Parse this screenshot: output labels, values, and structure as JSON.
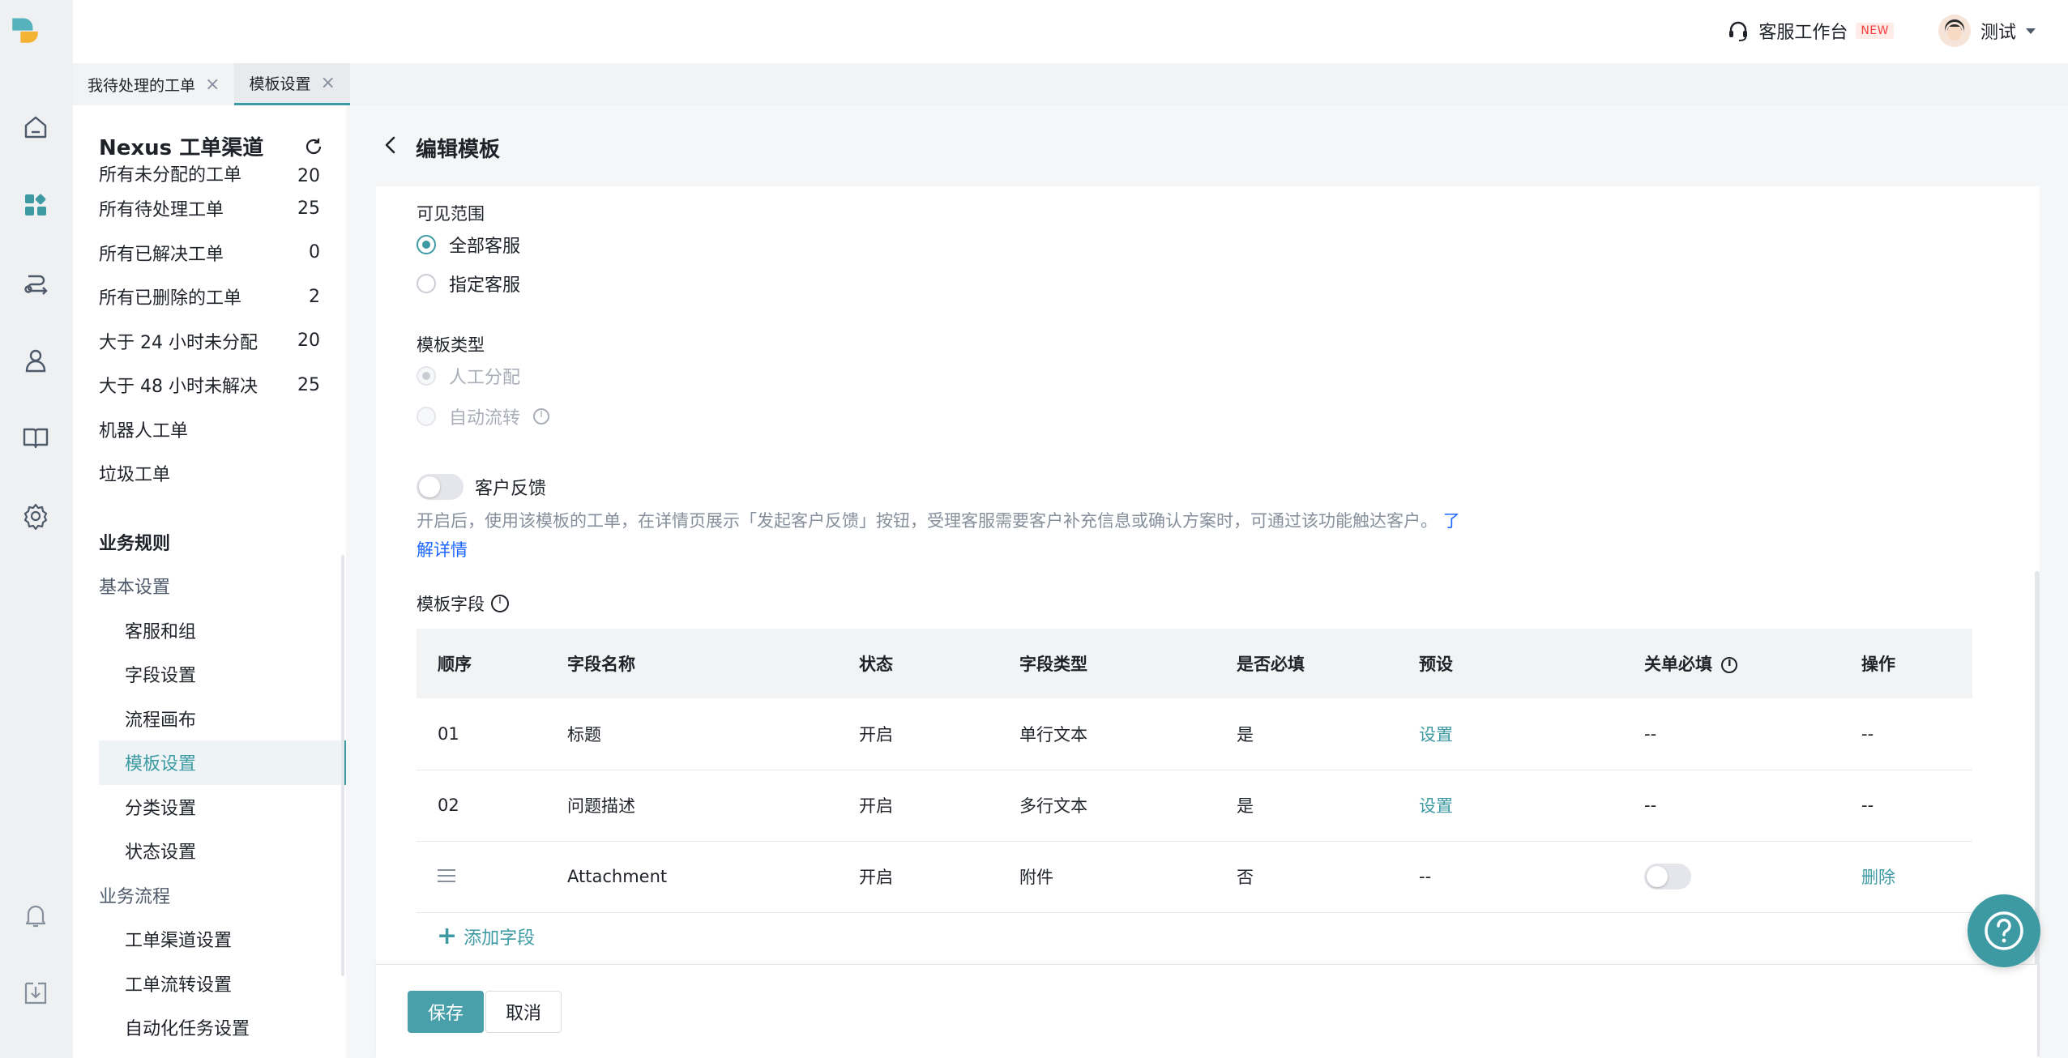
{
  "colors": {
    "accent": "#3d9aa3",
    "link": "#1a66ff",
    "danger": "#f53f3f"
  },
  "rail": {
    "icons": [
      "logo-icon",
      "home-icon",
      "apps-icon",
      "flow-icon",
      "user-icon",
      "book-icon",
      "gear-icon",
      "bell-icon",
      "download-icon"
    ]
  },
  "header": {
    "workbench_label": "客服工作台",
    "new_badge": "NEW",
    "user_name": "测试"
  },
  "tabs": [
    {
      "label": "我待处理的工单",
      "close": "×"
    },
    {
      "label": "模板设置",
      "close": "×"
    }
  ],
  "sidebar": {
    "title": "Nexus 工单渠道",
    "items": [
      {
        "label": "所有未分配的工单",
        "count": "20"
      },
      {
        "label": "所有待处理工单",
        "count": "25"
      },
      {
        "label": "所有已解决工单",
        "count": "0"
      },
      {
        "label": "所有已删除的工单",
        "count": "2"
      },
      {
        "label": "大于 24 小时未分配",
        "count": "20"
      },
      {
        "label": "大于 48 小时未解决",
        "count": "25"
      },
      {
        "label": "机器人工单",
        "count": ""
      },
      {
        "label": "垃圾工单",
        "count": ""
      }
    ],
    "business_rules": "业务规则",
    "basic_settings": "基本设置",
    "basic_items": [
      "客服和组",
      "字段设置",
      "流程画布",
      "模板设置",
      "分类设置",
      "状态设置"
    ],
    "business_flow": "业务流程",
    "flow_items": [
      "工单渠道设置",
      "工单流转设置",
      "自动化任务设置"
    ]
  },
  "main": {
    "title": "编辑模板",
    "visibility": {
      "label": "可见范围",
      "options": [
        "全部客服",
        "指定客服"
      ],
      "selected": "全部客服"
    },
    "template_type": {
      "label": "模板类型",
      "options": [
        "人工分配",
        "自动流转"
      ],
      "selected": "人工分配"
    },
    "feedback": {
      "label": "客户反馈",
      "enabled": false,
      "desc": "开启后，使用该模板的工单，在详情页展示「发起客户反馈」按钮，受理客服需要客户补充信息或确认方案时，可通过该功能触达客户。",
      "learn_more": "了解详情"
    },
    "fields": {
      "label": "模板字段",
      "columns": [
        "顺序",
        "字段名称",
        "状态",
        "字段类型",
        "是否必填",
        "预设",
        "关单必填",
        "操作"
      ],
      "rows": [
        {
          "order": "01",
          "name": "标题",
          "status": "开启",
          "type": "单行文本",
          "required": "是",
          "preset": "设置",
          "close_required": "--",
          "action": "--"
        },
        {
          "order": "02",
          "name": "问题描述",
          "status": "开启",
          "type": "多行文本",
          "required": "是",
          "preset": "设置",
          "close_required": "--",
          "action": "--"
        },
        {
          "order": "",
          "name": "Attachment",
          "status": "开启",
          "type": "附件",
          "required": "否",
          "preset": "--",
          "close_required": "off",
          "action": "删除"
        }
      ],
      "add_label": "添加字段"
    },
    "footer": {
      "save": "保存",
      "cancel": "取消"
    }
  },
  "help_icon": "question-icon"
}
